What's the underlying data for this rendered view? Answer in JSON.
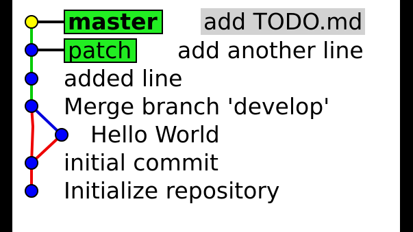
{
  "window": {
    "background_color": "#000000",
    "canvas_color": "#ffffff"
  },
  "colors": {
    "branch_tag_fill": "#22ee22",
    "head_node": "#ffff00",
    "commit_node": "#0000ff",
    "line_master": "#00cc00",
    "line_develop": "#0000dd",
    "line_initial": "#ee0000",
    "message_highlight": "#d2d2d2"
  },
  "branches": [
    {
      "name": "master",
      "current": true
    },
    {
      "name": "patch",
      "current": false
    }
  ],
  "commits": [
    {
      "message": "add TODO.md",
      "branch_label": "master",
      "head": true,
      "selected": true
    },
    {
      "message": "add another line",
      "branch_label": "patch",
      "head": false,
      "selected": false
    },
    {
      "message": "added line",
      "head": false,
      "selected": false
    },
    {
      "message": "Merge branch 'develop'",
      "head": false,
      "selected": false
    },
    {
      "message": "Hello World",
      "head": false,
      "selected": false
    },
    {
      "message": "initial commit",
      "head": false,
      "selected": false
    },
    {
      "message": "Initialize repository",
      "head": false,
      "selected": false
    }
  ]
}
